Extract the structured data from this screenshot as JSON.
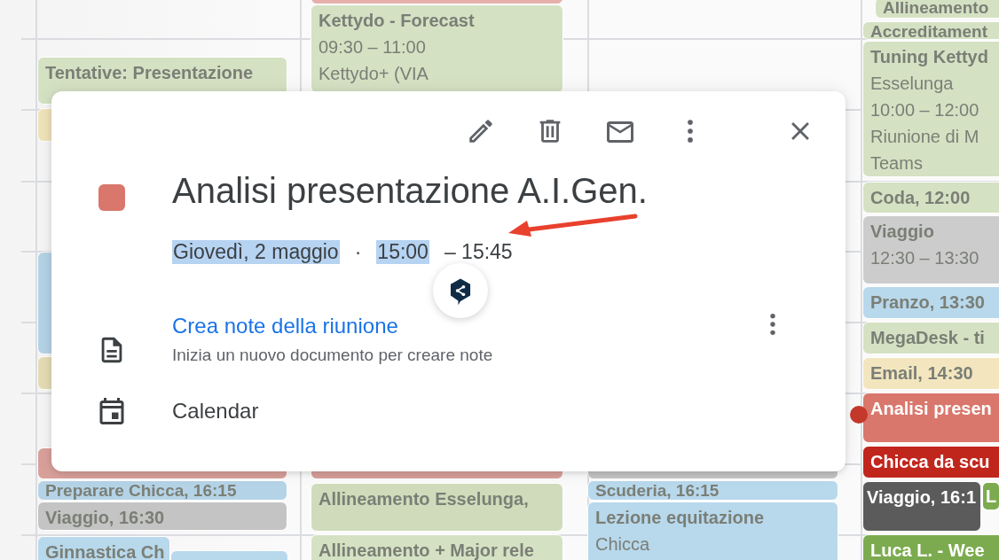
{
  "columns": [
    {
      "events": [
        {
          "lines": [
            "Tentative: Presentazione"
          ],
          "color": "#d5e1c3",
          "past": true
        },
        {
          "color": "#efe3b9"
        },
        {
          "color": "#b5d3e6"
        },
        {
          "color": "#e5dcb4"
        },
        {
          "color": "#d9a09a"
        },
        {
          "lines": [
            "Preparare Chicca, 16:15"
          ],
          "color": "#b5d3e6",
          "past": true
        },
        {
          "lines": [
            "Viaggio, 16:30"
          ],
          "color": "#c4c4c4",
          "past": true
        },
        {
          "lines": [
            "Ginnastica Ch"
          ],
          "color": "#b8d8ec",
          "past": true
        },
        {
          "color": "#b8d8ec"
        }
      ]
    },
    {
      "events": [
        {
          "color": "#e6b0aa"
        },
        {
          "lines": [
            "Kettydo - Forecast",
            "09:30 – 11:00",
            "Kettydo+ (VIA"
          ],
          "color": "#d5e1c3",
          "past": true
        },
        {
          "color": "#d9a09a"
        },
        {
          "lines": [
            "Allineamento Esselunga,"
          ],
          "color": "#d0dbbb",
          "past": true
        },
        {
          "lines": [
            "Allineamento + Major rele"
          ],
          "color": "#d5e1c3",
          "past": true
        }
      ]
    },
    {
      "events": [
        {
          "color": "#c4c4c4"
        },
        {
          "lines": [
            "Scuderia, 16:15"
          ],
          "color": "#b8d8ec",
          "past": true
        },
        {
          "lines": [
            "Lezione equitazione",
            "Chicca"
          ],
          "color": "#b8d8ec",
          "past": true
        }
      ]
    },
    {
      "events": [
        {
          "lines": [
            "Allineamento"
          ],
          "color": "#d5e1c3",
          "past": true
        },
        {
          "lines": [
            "Accreditament"
          ],
          "color": "#d5e1c3",
          "past": true
        },
        {
          "lines": [
            "Tuning Kettyd",
            "Esselunga",
            "10:00 – 12:00",
            "Riunione di M",
            "Teams"
          ],
          "color": "#d5e1c3",
          "past": true
        },
        {
          "lines": [
            "**Coda,** 12:00"
          ],
          "color": "#d5e1c3",
          "past": true
        },
        {
          "lines": [
            "Viaggio",
            "12:30 – 13:30"
          ],
          "color": "#cccccc",
          "past": true
        },
        {
          "lines": [
            "**Pranzo,** 13:30"
          ],
          "color": "#b8d8ec",
          "past": true
        },
        {
          "lines": [
            "MegaDesk - ti"
          ],
          "color": "#d5e1c3",
          "past": true
        },
        {
          "lines": [
            "**Email,** 14:30"
          ],
          "color": "#f3e6bf",
          "past": true
        },
        {
          "lines": [
            "Analisi presen"
          ],
          "color": "#d9776c",
          "past": false
        },
        {
          "lines": [
            "Chicca da scu"
          ],
          "color": "#c1261d",
          "past": false
        },
        {
          "lines": [
            "**Viaggio,** 16:1"
          ],
          "color": "#5b5b5b",
          "past": false
        },
        {
          "lines": [
            "L"
          ],
          "color": "#7cab4f",
          "past": false
        },
        {
          "lines": [
            "Luca L. - Wee"
          ],
          "color": "#7cab4f",
          "past": false
        }
      ]
    }
  ],
  "popup": {
    "color": "#d9776c",
    "title": "Analisi presentazione A.I.Gen.",
    "when": [
      {
        "text": "Giovedì, 2 maggio",
        "highlighted": true
      },
      {
        "text": "·",
        "highlighted": false
      },
      {
        "text": "15:00",
        "highlighted": true
      },
      {
        "text": "– 15:45",
        "highlighted": false
      }
    ],
    "notes_link": "Crea note della riunione",
    "notes_hint": "Inizia un nuovo documento per creare note",
    "calendar": "Calendar"
  }
}
